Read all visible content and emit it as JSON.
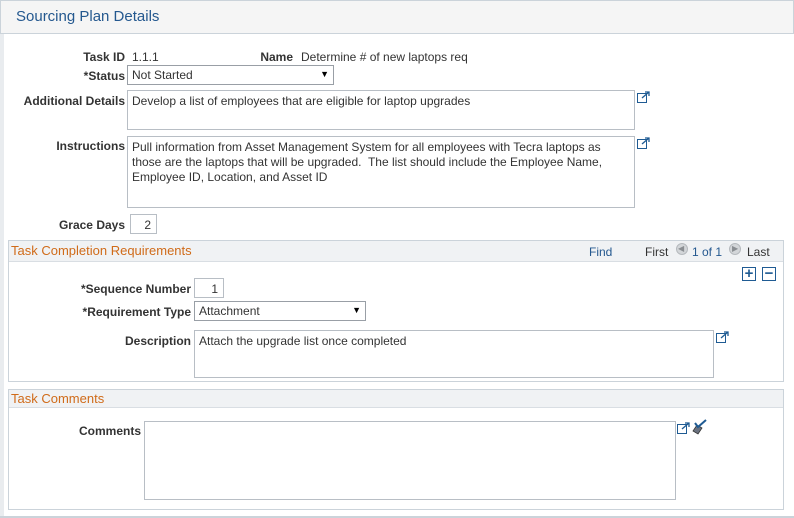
{
  "page": {
    "title": "Sourcing Plan Details"
  },
  "task": {
    "task_id_label": "Task ID",
    "task_id_value": "1.1.1",
    "name_label": "Name",
    "name_value": "Determine # of new laptops req",
    "status_label": "*Status",
    "status_value": "Not Started",
    "additional_details_label": "Additional Details",
    "additional_details_value": "Develop a list of employees that are eligible for laptop upgrades",
    "instructions_label": "Instructions",
    "instructions_value": "Pull information from Asset Management System for all employees with Tecra laptops as those are the laptops that will be upgraded.  The list should include the Employee Name, Employee ID, Location, and Asset ID",
    "grace_days_label": "Grace Days",
    "grace_days_value": "2"
  },
  "requirements": {
    "title": "Task Completion Requirements",
    "find_label": "Find",
    "first_label": "First",
    "page_info": "1 of 1",
    "last_label": "Last",
    "sequence_label": "*Sequence Number",
    "sequence_value": "1",
    "requirement_type_label": "*Requirement Type",
    "requirement_type_value": "Attachment",
    "description_label": "Description",
    "description_value": "Attach the upgrade list once completed"
  },
  "comments": {
    "title": "Task Comments",
    "comments_label": "Comments",
    "comments_value": ""
  },
  "icons": {
    "expand": "expand-textbox-icon",
    "spellcheck": "spellcheck-icon",
    "prev": "previous-row-icon",
    "next": "next-row-icon",
    "add": "add-row-icon",
    "delete": "delete-row-icon"
  },
  "colors": {
    "title_blue": "#24588f",
    "group_orange": "#d06b19",
    "link_blue": "#24588f"
  }
}
